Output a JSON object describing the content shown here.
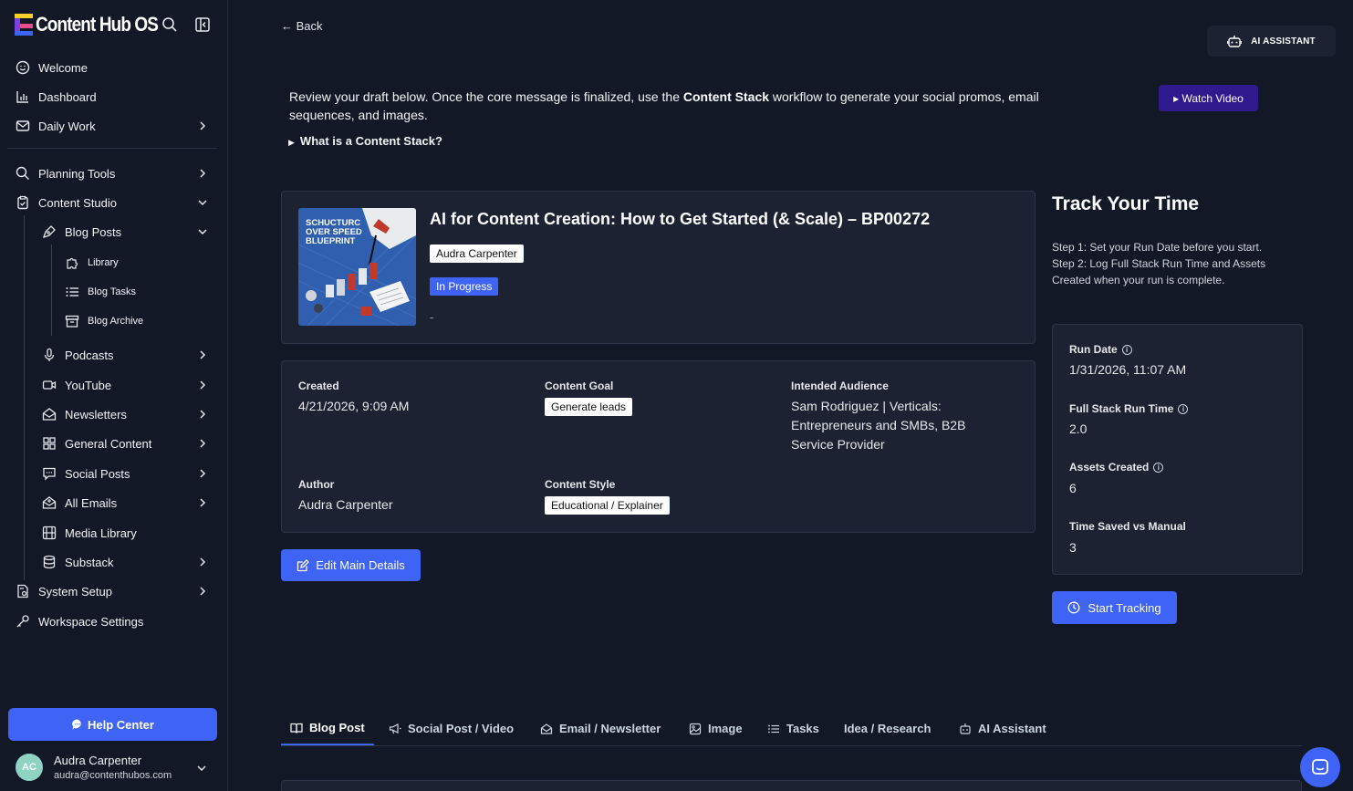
{
  "app": {
    "name": "Content Hub OS",
    "brand_colors": {
      "yellow": "#f7d02c",
      "purple": "#7b3fe4",
      "pink": "#e94b8b",
      "blue": "#3e63f5"
    }
  },
  "sidebar": {
    "items": [
      {
        "label": "Welcome",
        "icon": "smile-icon"
      },
      {
        "label": "Dashboard",
        "icon": "bar-chart-icon"
      },
      {
        "label": "Daily Work",
        "icon": "mail-icon"
      },
      {
        "label": "Planning Tools",
        "icon": "search-icon"
      },
      {
        "label": "Content Studio",
        "icon": "clipboard-icon"
      },
      {
        "label": "Blog Posts",
        "icon": "pen-tool-icon"
      },
      {
        "label": "Library",
        "icon": "puzzle-icon"
      },
      {
        "label": "Blog Tasks",
        "icon": "list-icon"
      },
      {
        "label": "Blog Archive",
        "icon": "archive-icon"
      },
      {
        "label": "Podcasts",
        "icon": "microphone-icon"
      },
      {
        "label": "YouTube",
        "icon": "video-icon"
      },
      {
        "label": "Newsletters",
        "icon": "envelope-open-icon"
      },
      {
        "label": "General Content",
        "icon": "grid-icon"
      },
      {
        "label": "Social Posts",
        "icon": "message-icon"
      },
      {
        "label": "All Emails",
        "icon": "mail-plus-icon"
      },
      {
        "label": "Media Library",
        "icon": "film-icon"
      },
      {
        "label": "Substack",
        "icon": "database-icon"
      },
      {
        "label": "System Setup",
        "icon": "file-settings-icon"
      },
      {
        "label": "Workspace Settings",
        "icon": "key-icon"
      }
    ],
    "help_center": "Help Center",
    "user": {
      "initials": "AC",
      "name": "Audra Carpenter",
      "email": "audra@contenthubos.com"
    }
  },
  "header": {
    "back": "← Back",
    "ai_assistant": "AI ASSISTANT"
  },
  "intro": {
    "text_before": "Review your draft below. Once the core message is finalized, use the ",
    "text_bold": "Content Stack",
    "text_after": " workflow to generate your social promos, email sequences, and images.",
    "watch_video": "▸ Watch Video",
    "details_summary": "What is a Content Stack?"
  },
  "post": {
    "title": "AI for Content Creation: How to Get Started (& Scale) – BP00272",
    "author_chip": "Audra Carpenter",
    "status": "In Progress",
    "dash": "-",
    "thumbnail_text": "SCHUCTURC OVER SPEED BLUEPRINT"
  },
  "details": {
    "created_label": "Created",
    "created_value": "4/21/2026, 9:09 AM",
    "goal_label": "Content Goal",
    "goal_value": "Generate leads",
    "audience_label": "Intended Audience",
    "audience_value": "Sam Rodriguez | Verticals: Entrepreneurs and SMBs, B2B Service Provider",
    "author_label": "Author",
    "author_value": "Audra Carpenter",
    "style_label": "Content Style",
    "style_value": "Educational / Explainer"
  },
  "edit_button": "Edit Main Details",
  "track": {
    "title": "Track Your Time",
    "step1": "Step 1: Set your Run Date before you start.",
    "step2": "Step 2: Log Full Stack Run Time and Assets Created when your run is complete.",
    "run_date_label": "Run Date",
    "run_date_value": "1/31/2026, 11:07 AM",
    "run_time_label": "Full Stack Run Time",
    "run_time_value": "2.0",
    "assets_label": "Assets Created",
    "assets_value": "6",
    "saved_label": "Time Saved vs Manual",
    "saved_value": "3",
    "start_button": "Start Tracking"
  },
  "tabs": [
    {
      "label": "Blog Post",
      "icon": "book-icon",
      "active": true
    },
    {
      "label": "Social Post / Video",
      "icon": "megaphone-icon",
      "active": false
    },
    {
      "label": "Email / Newsletter",
      "icon": "envelope-open-icon",
      "active": false
    },
    {
      "label": "Image",
      "icon": "image-icon",
      "active": false
    },
    {
      "label": "Tasks",
      "icon": "list-icon",
      "active": false
    },
    {
      "label": "Idea / Research",
      "icon": "",
      "active": false
    },
    {
      "label": "AI Assistant",
      "icon": "robot-icon",
      "active": false
    }
  ]
}
